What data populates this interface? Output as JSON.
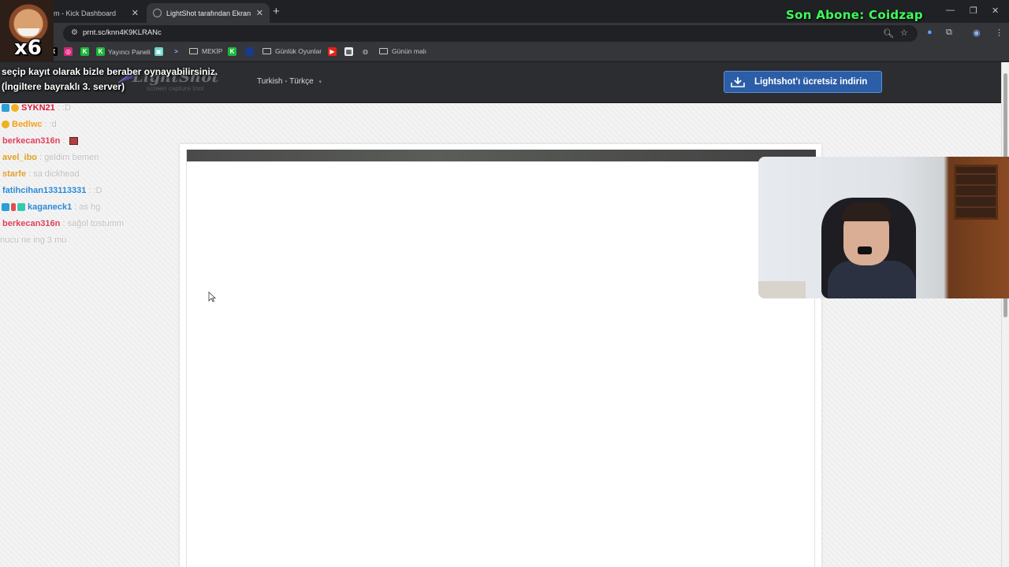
{
  "browser": {
    "tabs": [
      {
        "label": "m - Kick Dashboard",
        "active": false
      },
      {
        "label": "LightShot tarafından Ekran Görü",
        "active": true
      }
    ],
    "new_tab_icon": "plus-icon",
    "url": "prnt.sc/knn4K9KLRANc",
    "bookmarks": [
      {
        "label": "",
        "icon": "x-icon"
      },
      {
        "label": "",
        "icon": "instagram-icon"
      },
      {
        "label": "",
        "icon": "kick-icon"
      },
      {
        "label": "Yayıncı Paneli",
        "icon": "kick-icon"
      },
      {
        "label": "",
        "icon": "twitch-icon"
      },
      {
        "label": "",
        "icon": "prompt-icon"
      },
      {
        "label": "MEKİP",
        "icon": "folder-icon"
      },
      {
        "label": "",
        "icon": "kick-icon"
      },
      {
        "label": "",
        "icon": "bookmark-icon"
      },
      {
        "label": "Günlük Oyunlar",
        "icon": "folder-icon"
      },
      {
        "label": "",
        "icon": "youtube-icon"
      },
      {
        "label": "",
        "icon": "image-icon"
      },
      {
        "label": "",
        "icon": "globe-icon"
      },
      {
        "label": "Günün malı",
        "icon": "folder-icon"
      }
    ]
  },
  "lightshot": {
    "logo": "LightShot",
    "tagline": "screen capture tool",
    "language": "Turkish - Türkçe",
    "download_button": "Lightshot'ı ücretsiz indirin",
    "brand_color": "#2b5ea6"
  },
  "overlay": {
    "sub_alert": "Son Abone: Coidzap",
    "emote_multiplier": "x6",
    "alert_lines": [
      "seçip kayıt olarak bizle beraber oynayabilirsiniz.",
      "(İngiltere bayraklı 3. server)"
    ],
    "chat": [
      {
        "user": "SYKN21",
        "color": "#d81b3a",
        "message": ": :D",
        "badges": [
          "square",
          "coin"
        ]
      },
      {
        "user": "Bedlwc",
        "color": "#f0a020",
        "message": ": :d",
        "badges": [
          "coin"
        ]
      },
      {
        "user": "berkecan316n",
        "color": "#e0405a",
        "message": ":",
        "badges": [],
        "emote": true
      },
      {
        "user": "avel_ibo",
        "color": "#e0a020",
        "message": ": geldim bemen",
        "badges": []
      },
      {
        "user": "starfe",
        "color": "#e0a030",
        "message": ": sa dickhead",
        "badges": []
      },
      {
        "user": "fatihcihan133113331",
        "color": "#2a8ad8",
        "message": ": :D",
        "badges": []
      },
      {
        "user": "kaganeck1",
        "color": "#2a8ad8",
        "message": ": as hg",
        "badges": [
          "square",
          "pen",
          "gem"
        ]
      },
      {
        "user": "berkecan316n",
        "color": "#e0405a",
        "message": ": sağol tostumm",
        "badges": []
      },
      {
        "user": "",
        "color": "#c0c0c0",
        "message": "nucu ne ing 3 mu",
        "badges": []
      }
    ]
  }
}
